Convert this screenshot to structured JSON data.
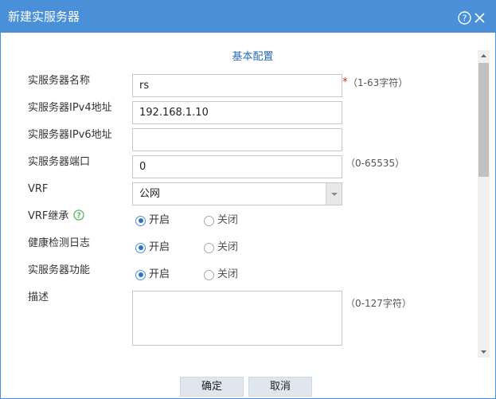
{
  "dialog": {
    "title": "新建实服务器",
    "help_icon": "question-circle-icon",
    "close_icon": "close-icon"
  },
  "section_title": "基本配置",
  "fields": {
    "name": {
      "label": "实服务器名称",
      "value": "rs",
      "required_mark": "*",
      "hint": "（1-63字符）"
    },
    "ipv4": {
      "label": "实服务器IPv4地址",
      "value": "192.168.1.10"
    },
    "ipv6": {
      "label": "实服务器IPv6地址",
      "value": ""
    },
    "port": {
      "label": "实服务器端口",
      "value": "0",
      "hint": "（0-65535）"
    },
    "vrf": {
      "label": "VRF",
      "selected": "公网"
    },
    "vrf_inherit": {
      "label": "VRF继承",
      "on_label": "开启",
      "off_label": "关闭",
      "selected": "开启"
    },
    "health_log": {
      "label": "健康检测日志",
      "on_label": "开启",
      "off_label": "关闭",
      "selected": "开启"
    },
    "server_function": {
      "label": "实服务器功能",
      "on_label": "开启",
      "off_label": "关闭",
      "selected": "开启"
    },
    "description": {
      "label": "描述",
      "value": "",
      "hint": "（0-127字符）"
    }
  },
  "buttons": {
    "ok": "确定",
    "cancel": "取消"
  },
  "colors": {
    "titlebar": "#4a90d9",
    "accent": "#2a6bb5",
    "required": "#e02020",
    "help_green": "#5cb85c"
  }
}
